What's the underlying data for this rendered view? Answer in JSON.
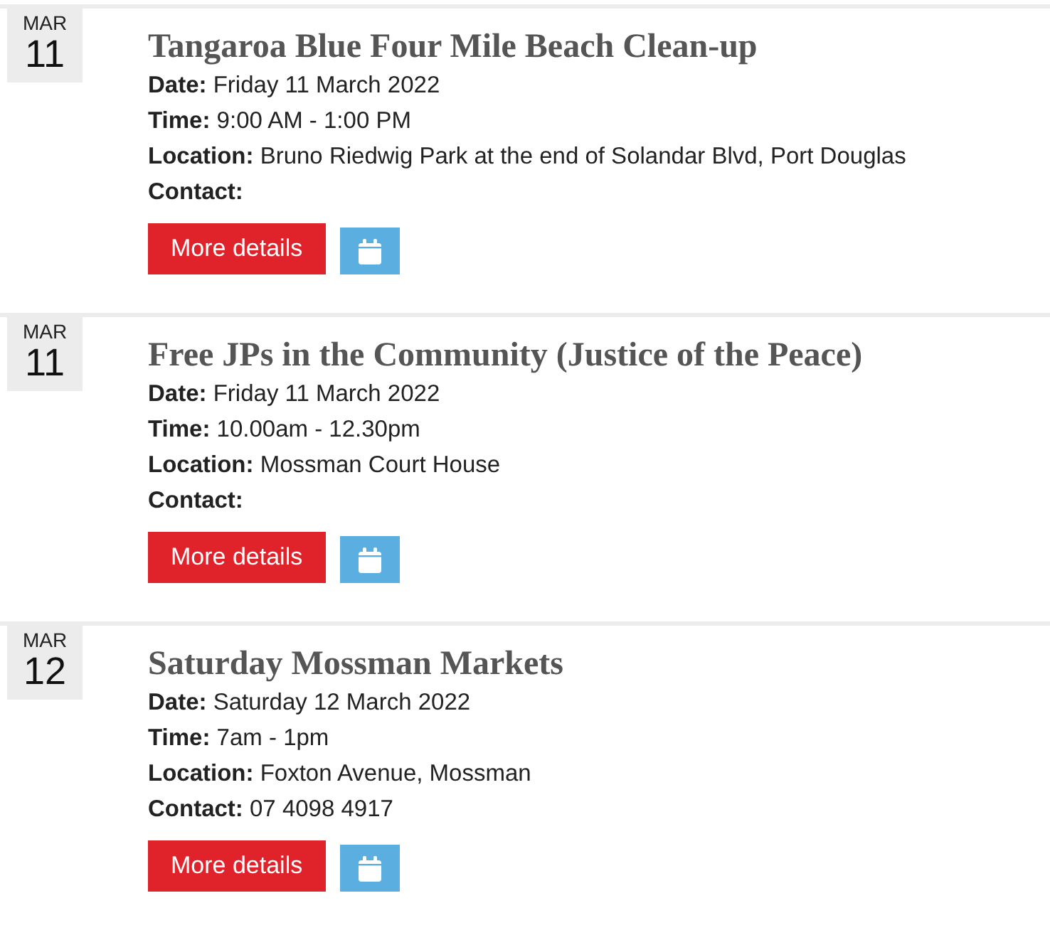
{
  "events": [
    {
      "month": "MAR",
      "day": "11",
      "title": "Tangaroa Blue Four Mile Beach Clean-up",
      "details": [
        "**Date:** Friday 11 March 2022",
        "**Time:** 9:00 AM - 1:00 PM",
        "**Location:** Bruno Riedwig Park at the end of Solandar Blvd, Port Douglas",
        "**Contact:**"
      ],
      "more_button": "More details"
    },
    {
      "month": "MAR",
      "day": "11",
      "title": "Free JPs in the Community (Justice of the Peace)",
      "details": [
        "**Date:** Friday 11 March 2022",
        "**Time:** 10.00am - 12.30pm",
        "**Location:** Mossman Court House",
        "**Contact:**"
      ],
      "more_button": "More details"
    },
    {
      "month": "MAR",
      "day": "12",
      "title": "Saturday Mossman Markets",
      "details": [
        "**Date:** Saturday 12 March 2022",
        "**Time:** 7am - 1pm",
        "**Location:** Foxton Avenue, Mossman",
        "**Contact:** 07 4098 4917"
      ],
      "more_button": "More details"
    }
  ]
}
